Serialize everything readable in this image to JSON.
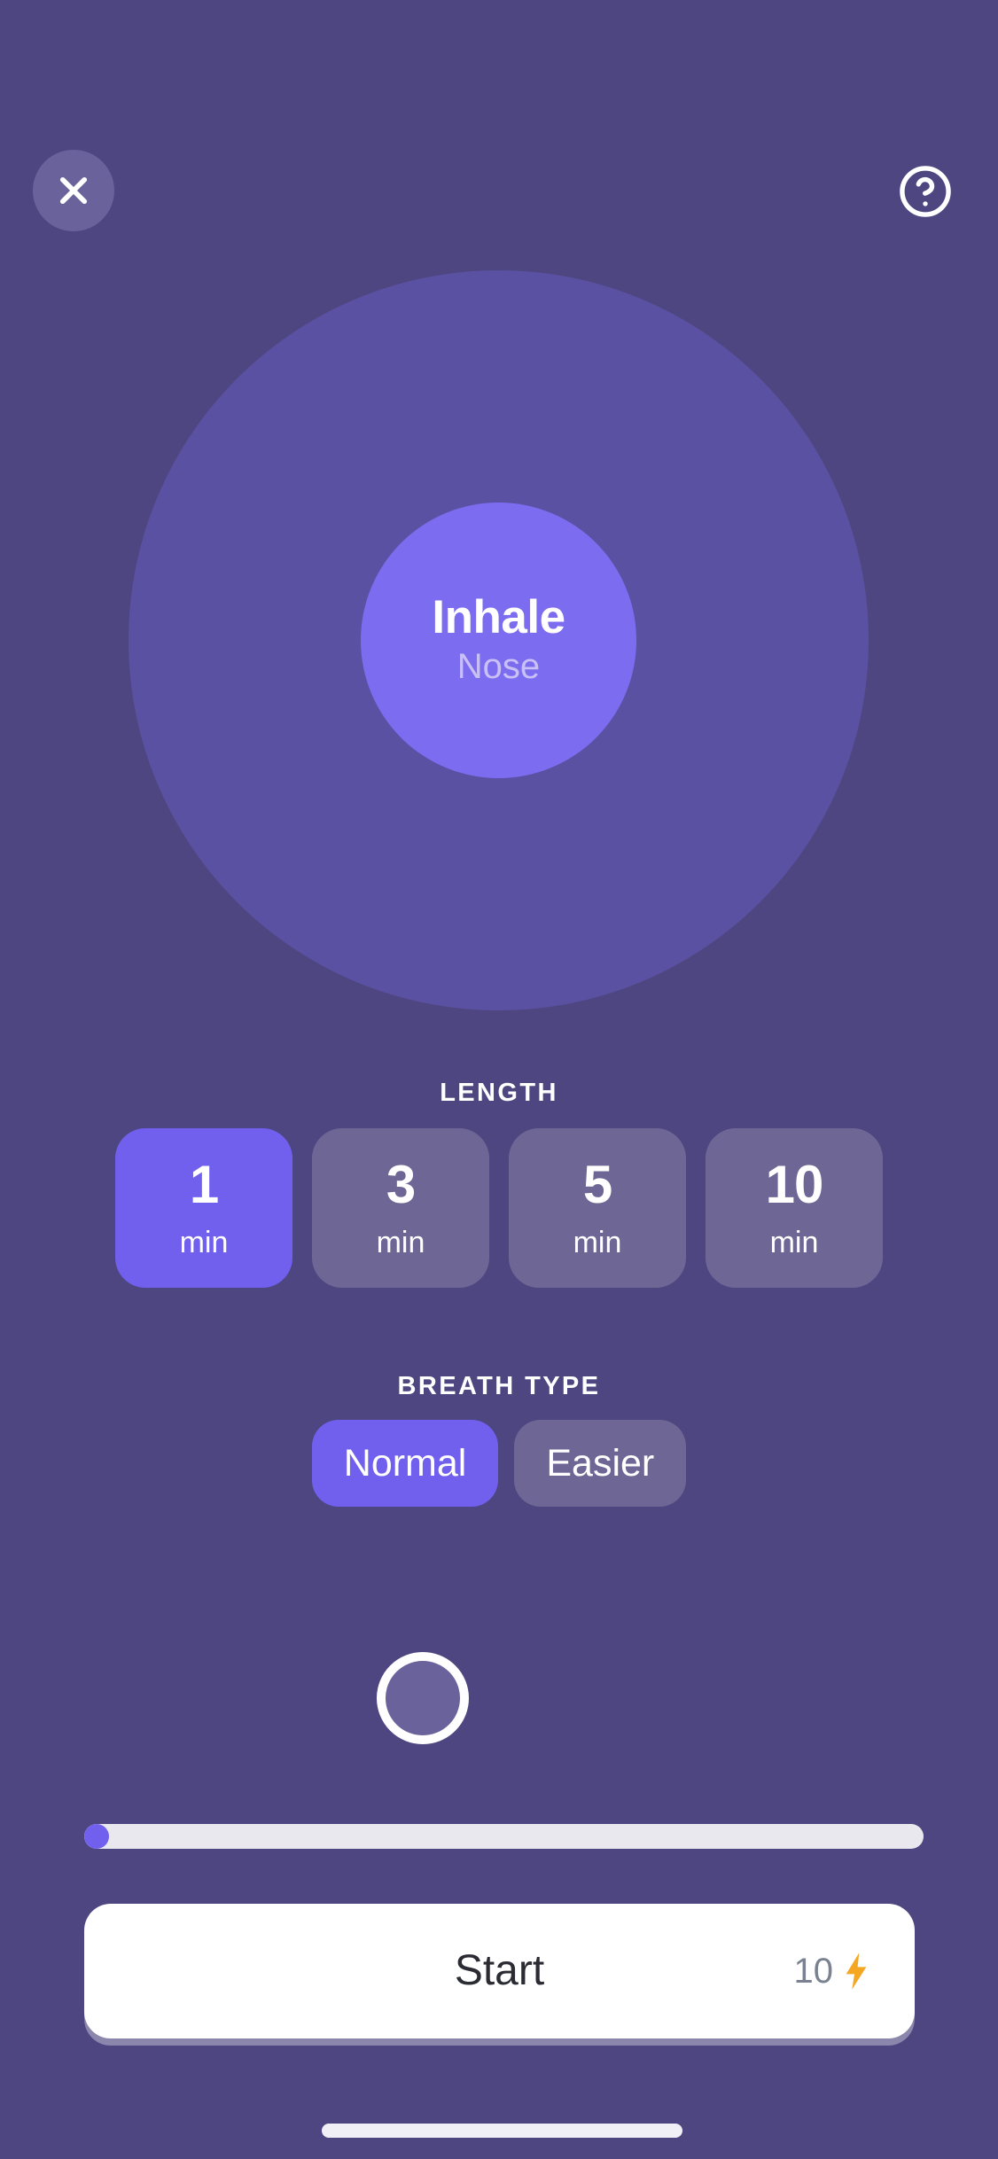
{
  "theme": {
    "background": "#4E4680",
    "circle_outer": "#5B51A3",
    "circle_inner": "#7C6CF0",
    "accent_selected": "#7160EE",
    "chip_unselected": "#6E6795",
    "button_surface": "#FFFFFF",
    "bolt_color": "#F5A623",
    "progress_track": "#E8E8EE"
  },
  "header": {
    "close_icon": "close-icon",
    "help_icon": "question-mark-circle-icon"
  },
  "breath_visual": {
    "phase": "Inhale",
    "method": "Nose"
  },
  "length": {
    "label": "LENGTH",
    "options": [
      {
        "value": "1",
        "unit": "min",
        "selected": true
      },
      {
        "value": "3",
        "unit": "min",
        "selected": false
      },
      {
        "value": "5",
        "unit": "min",
        "selected": false
      },
      {
        "value": "10",
        "unit": "min",
        "selected": false
      }
    ]
  },
  "breath_type": {
    "label": "BREATH TYPE",
    "options": [
      {
        "label": "Normal",
        "selected": true
      },
      {
        "label": "Easier",
        "selected": false
      }
    ]
  },
  "status_ring": {
    "icon": "circle-outline-icon"
  },
  "progress": {
    "percent": 3
  },
  "start": {
    "label": "Start",
    "count": "10",
    "bolt_icon": "lightning-bolt-icon"
  },
  "home_indicator": {
    "icon": "home-indicator-bar"
  }
}
